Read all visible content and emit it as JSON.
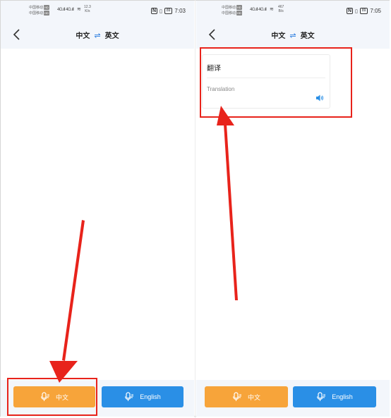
{
  "screens": [
    {
      "status": {
        "carrier1": "中国移动",
        "carrier2": "中国移动",
        "badge1": "HD",
        "badge2": "HD",
        "signal": "4G.ıll 4G.ıll",
        "speed_value": "12.3",
        "speed_unit": "K/s",
        "time": "7:03",
        "nfc": "N",
        "battery": "89"
      },
      "nav": {
        "source_lang": "中文",
        "swap_symbol": "⇌",
        "target_lang": "英文"
      },
      "buttons": {
        "chinese_label": "中文",
        "english_label": "English"
      }
    },
    {
      "status": {
        "carrier1": "中国移动",
        "carrier2": "中国移动",
        "badge1": "HD",
        "badge2": "HD",
        "signal": "4G.ıll 4G.ıll",
        "speed_value": "467",
        "speed_unit": "B/s",
        "time": "7:05",
        "nfc": "N",
        "battery": "89"
      },
      "nav": {
        "source_lang": "中文",
        "swap_symbol": "⇌",
        "target_lang": "英文"
      },
      "result": {
        "source_text": "翻译",
        "translation_text": "Translation"
      },
      "buttons": {
        "chinese_label": "中文",
        "english_label": "English"
      }
    }
  ],
  "colors": {
    "accent_orange": "#f7a43a",
    "accent_blue": "#2a8fe6",
    "annotation_red": "#e8231b",
    "header_bg": "#f3f6fb"
  }
}
